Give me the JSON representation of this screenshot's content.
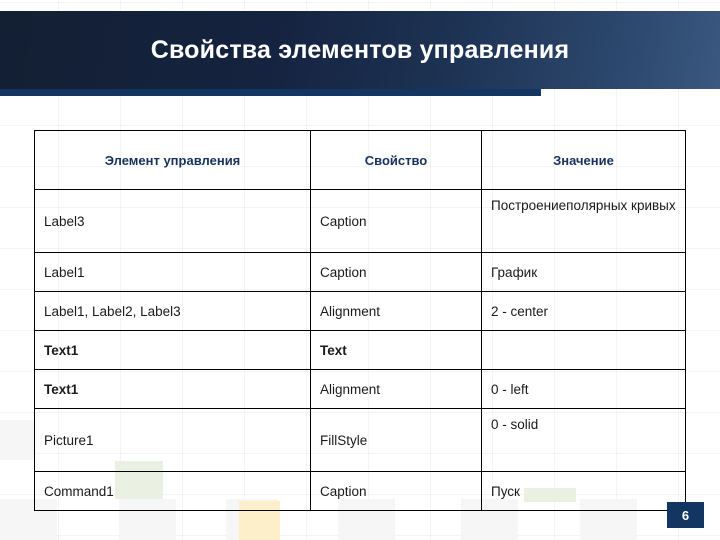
{
  "slide": {
    "title": "Свойства элементов управления",
    "page_number": "6",
    "accent_dark": "#123562",
    "header_gradient_from": "#131f33",
    "header_gradient_to": "#3a5880",
    "header_text_color": "#ffffff",
    "table_header_text_color": "#16325c",
    "table_border_color": "#000000"
  },
  "table": {
    "headers": [
      "Элемент управления",
      "Свойство",
      "Значение"
    ],
    "rows": [
      {
        "control": "Label3",
        "property": "Caption",
        "value": "Построениеполярных кривых"
      },
      {
        "control": "Label1",
        "property": "Caption",
        "value": "График"
      },
      {
        "control": "Label1, Label2,  Label3",
        "property": "Alignment",
        "value": "2 - center"
      },
      {
        "control": "Text1",
        "property": "Text",
        "value": ""
      },
      {
        "control": "Text1",
        "property": "Alignment",
        "value": "0 - left"
      },
      {
        "control": "Picture1",
        "property": "FillStyle",
        "value": "0 - solid"
      },
      {
        "control": "Command1",
        "property": "Caption",
        "value": "Пуск"
      }
    ]
  }
}
